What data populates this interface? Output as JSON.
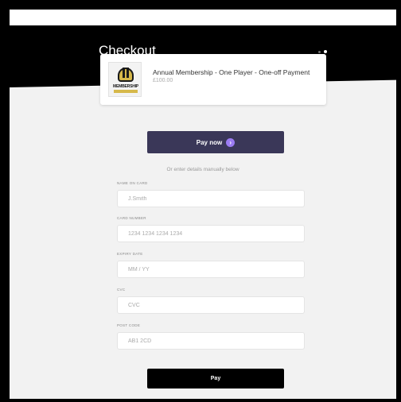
{
  "header": {
    "title": "Checkout"
  },
  "product": {
    "logo_text": "MEMBERSHIP",
    "name": "Annual Membership - One Player - One-off Payment",
    "price": "£100.00"
  },
  "pay_now": {
    "label": "Pay now",
    "icon": "chevron-right-icon"
  },
  "divider_text": "Or enter details manually below",
  "fields": {
    "name": {
      "label": "NAME ON CARD",
      "placeholder": "J.Smith"
    },
    "card": {
      "label": "CARD NUMBER",
      "placeholder": "1234 1234 1234 1234"
    },
    "expiry": {
      "label": "EXPIRY DATE",
      "placeholder": "MM / YY"
    },
    "cvc": {
      "label": "CVC",
      "placeholder": "CVC"
    },
    "postcode": {
      "label": "POST CODE",
      "placeholder": "AB1 2CD"
    }
  },
  "pay": {
    "label": "Pay"
  },
  "colors": {
    "accent": "#3a3758",
    "accent_icon": "#9b7cf2",
    "header": "#000000"
  }
}
